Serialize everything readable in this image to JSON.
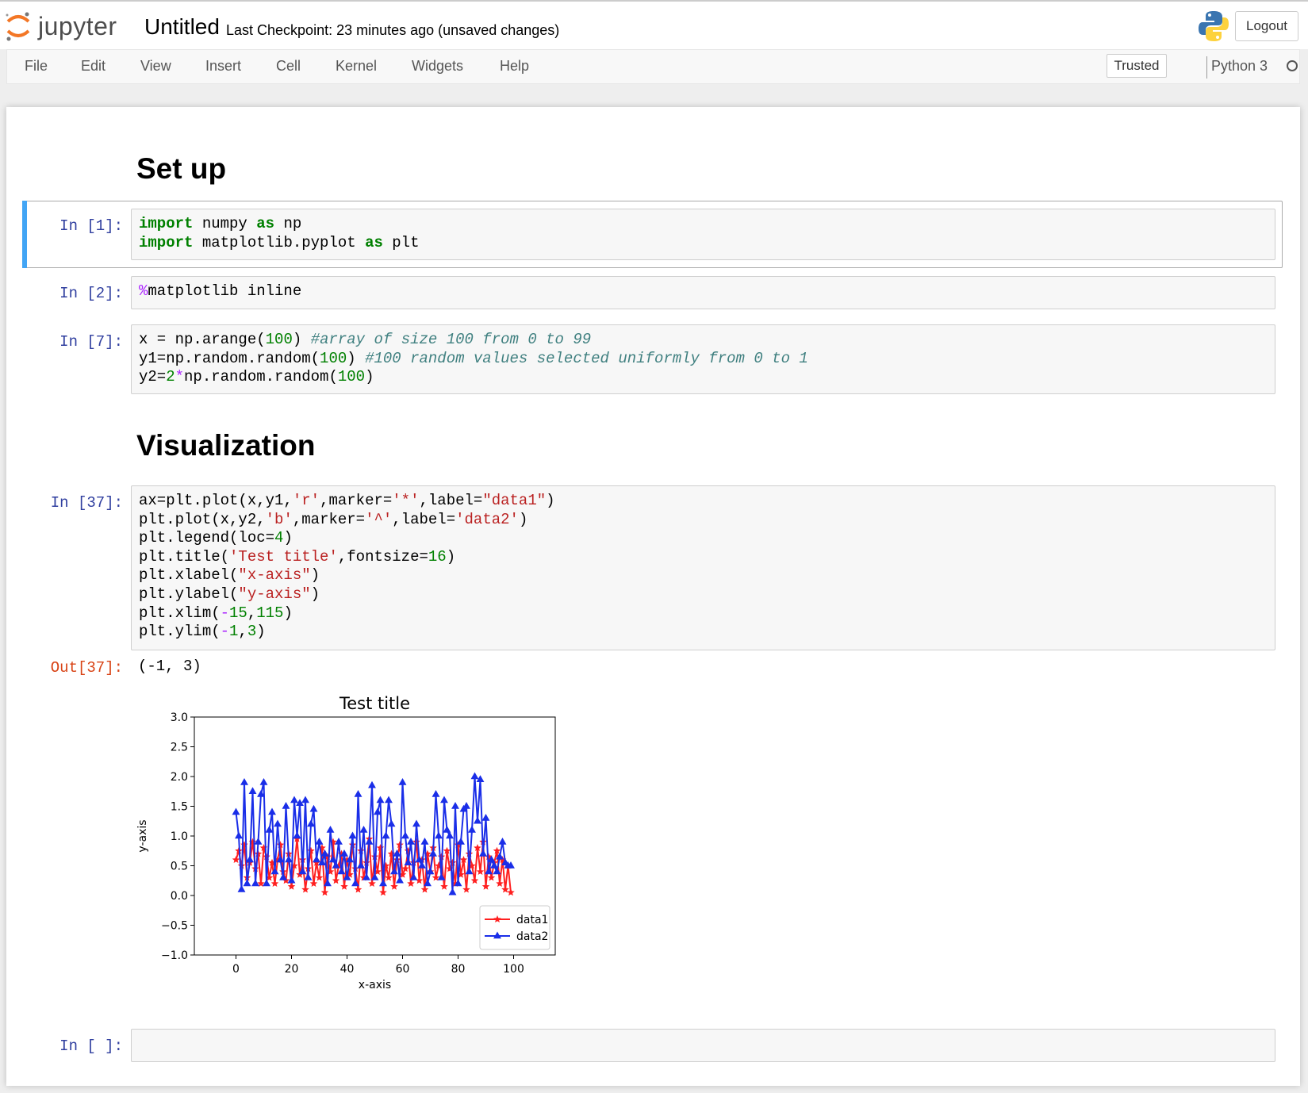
{
  "header": {
    "logo_text": "jupyter",
    "notebook_title": "Untitled",
    "checkpoint": "Last Checkpoint: 23 minutes ago (unsaved changes)",
    "logout_label": "Logout"
  },
  "menu": {
    "items": [
      "File",
      "Edit",
      "View",
      "Insert",
      "Cell",
      "Kernel",
      "Widgets",
      "Help"
    ],
    "trusted_label": "Trusted",
    "kernel_name": "Python 3"
  },
  "cells": {
    "heading1": "Set up",
    "heading2": "Visualization",
    "prompts": [
      "In [1]:",
      "In [2]:",
      "In [7]:",
      "In [37]:",
      "Out[37]:",
      "In [ ]:"
    ],
    "code1": [
      "import numpy as np",
      "import matplotlib.pyplot as plt"
    ],
    "code2": [
      "%matplotlib inline"
    ],
    "code3": [
      "x = np.arange(100) #array of size 100 from 0 to 99",
      "y1=np.random.random(100) #100 random values selected uniformly from 0 to 1",
      "y2=2*np.random.random(100)"
    ],
    "code4": [
      "ax=plt.plot(x,y1,'r',marker='*',label=\"data1\")",
      "plt.plot(x,y2,'b',marker='^',label='data2')",
      "plt.legend(loc=4)",
      "plt.title('Test title',fontsize=16)",
      "plt.xlabel(\"x-axis\")",
      "plt.ylabel(\"y-axis\")",
      "plt.xlim(-15,115)",
      "plt.ylim(-1,3)"
    ],
    "output_text": "(-1, 3)"
  },
  "chart_data": {
    "type": "line",
    "title": "Test title",
    "xlabel": "x-axis",
    "ylabel": "y-axis",
    "xlim": [
      -15,
      115
    ],
    "ylim": [
      -1,
      3
    ],
    "xticks": [
      "0",
      "20",
      "40",
      "60",
      "80",
      "100"
    ],
    "yticks": [
      "3.0",
      "2.5",
      "2.0",
      "1.5",
      "1.0",
      "0.5",
      "0.0",
      "−0.5",
      "−1.0"
    ],
    "grid": false,
    "legend_position": "lower right",
    "colors": {
      "data1": "#ff2020",
      "data2": "#1a2ee8"
    },
    "series": [
      {
        "name": "data1",
        "marker": "star",
        "values": [
          0.6,
          0.75,
          0.5,
          0.85,
          0.3,
          0.55,
          0.9,
          0.45,
          0.7,
          0.2,
          0.8,
          0.65,
          0.3,
          0.55,
          0.2,
          0.6,
          0.85,
          0.4,
          0.25,
          0.7,
          0.15,
          0.5,
          0.95,
          0.35,
          0.6,
          0.1,
          0.45,
          0.75,
          0.2,
          0.55,
          0.3,
          0.8,
          0.05,
          0.65,
          0.4,
          0.9,
          0.25,
          0.5,
          0.7,
          0.15,
          0.6,
          0.35,
          0.85,
          0.45,
          0.1,
          0.75,
          0.3,
          0.55,
          0.95,
          0.2,
          0.65,
          0.4,
          0.8,
          0.05,
          0.5,
          0.3,
          0.7,
          0.15,
          0.6,
          0.85,
          0.35,
          0.45,
          0.75,
          0.2,
          0.55,
          0.9,
          0.25,
          0.6,
          0.1,
          0.7,
          0.4,
          0.8,
          0.3,
          0.5,
          0.65,
          0.15,
          0.75,
          0.45,
          0.55,
          0.2,
          0.85,
          0.35,
          0.6,
          0.1,
          0.7,
          0.5,
          0.25,
          0.8,
          0.4,
          0.9,
          0.15,
          0.65,
          0.3,
          0.55,
          0.75,
          0.2,
          0.6,
          0.1,
          0.5,
          0.05
        ]
      },
      {
        "name": "data2",
        "marker": "triangle",
        "values": [
          1.4,
          1.0,
          0.1,
          1.9,
          0.2,
          0.6,
          1.75,
          0.2,
          0.9,
          1.7,
          1.9,
          0.2,
          1.1,
          1.4,
          0.4,
          1.2,
          0.6,
          0.3,
          1.5,
          0.6,
          0.25,
          1.6,
          1.0,
          1.55,
          0.4,
          1.6,
          0.3,
          1.2,
          1.45,
          0.6,
          0.9,
          0.55,
          0.7,
          0.2,
          1.1,
          0.6,
          0.5,
          0.9,
          0.4,
          0.7,
          0.3,
          0.6,
          1.0,
          0.2,
          1.7,
          0.5,
          1.1,
          0.3,
          0.9,
          1.85,
          0.3,
          1.4,
          1.6,
          0.2,
          1.0,
          1.6,
          1.2,
          0.4,
          0.7,
          0.25,
          1.9,
          1.0,
          0.55,
          0.9,
          0.3,
          1.2,
          0.6,
          0.5,
          0.9,
          0.2,
          0.4,
          0.7,
          1.7,
          1.0,
          0.3,
          1.6,
          1.1,
          1.0,
          0.05,
          1.5,
          0.2,
          0.9,
          1.45,
          1.5,
          0.4,
          1.1,
          2.0,
          1.25,
          1.95,
          0.7,
          1.3,
          0.4,
          0.6,
          0.5,
          0.4,
          0.65,
          0.9,
          0.55,
          0.5,
          0.5
        ]
      }
    ]
  }
}
